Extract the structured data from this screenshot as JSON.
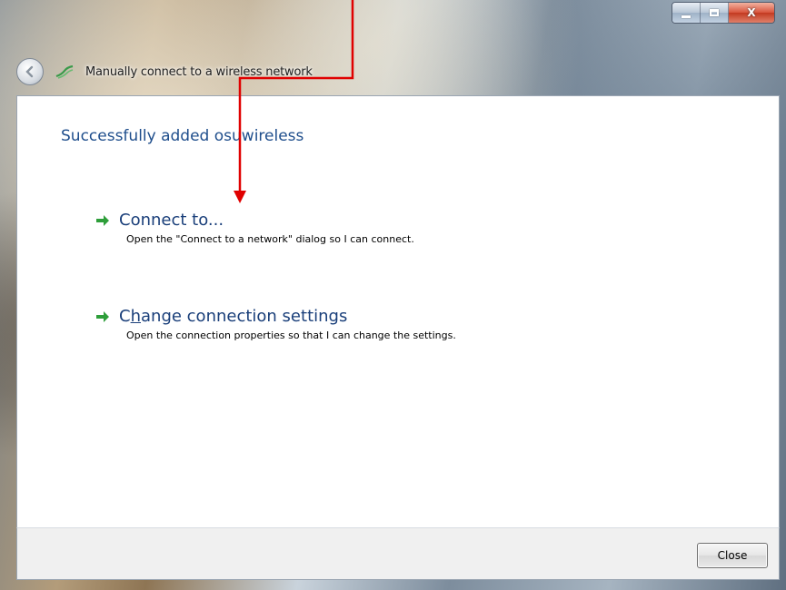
{
  "window": {
    "nav_title": "Manually connect to a wireless network",
    "caption": {
      "close_glyph": "X"
    }
  },
  "content": {
    "heading": "Successfully added osuwireless",
    "options": [
      {
        "title_prefix": "Connect to...",
        "description": "Open the \"Connect to a network\" dialog so I can connect.",
        "icon": "green-arrow-icon"
      },
      {
        "title_prefix": "C",
        "title_accel": "h",
        "title_suffix": "ange connection settings",
        "description": "Open the connection properties so that I can change the settings.",
        "icon": "green-arrow-icon"
      }
    ]
  },
  "footer": {
    "close_label": "Close"
  },
  "colors": {
    "annotation": "#e00000",
    "accent_text": "#1f4e8c",
    "arrow": "#2e9e3a"
  }
}
